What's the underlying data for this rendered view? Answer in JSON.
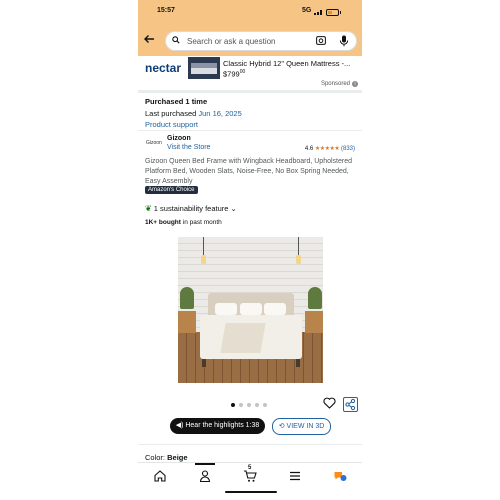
{
  "status": {
    "time": "15:57",
    "network": "5G"
  },
  "search": {
    "placeholder": "Search or ask a question"
  },
  "ad": {
    "brand": "nectar",
    "title": "Classic Hybrid 12\" Queen Mattress -...",
    "price_whole": "$799",
    "price_fraction": "00",
    "sponsored": "Sponsored",
    "info_icon": "i"
  },
  "purchase": {
    "times": "Purchased 1 time",
    "last_prefix": "Last purchased",
    "last_date": "Jun 16, 2025",
    "support": "Product support"
  },
  "seller": {
    "logo": "Gizoon",
    "name": "Gizoon",
    "store_link": "Visit the Store",
    "rating": "4.6",
    "stars": "★★★★★",
    "review_count": "(833)"
  },
  "product": {
    "description": "Gizoon Queen Bed Frame with Wingback Headboard, Upholstered Platform Bed, Wooden Slats, Noise-Free, No Box Spring Needed, Easy Assembly",
    "badge": "Amazon's Choice",
    "sustainability": "1 sustainability feature",
    "bought_bold": "1K+ bought",
    "bought_rest": " in past month"
  },
  "gallery": {
    "dot_count": 5,
    "active_dot": 0
  },
  "actions": {
    "highlights": "Hear the highlights 1:38",
    "view3d": "VIEW IN 3D"
  },
  "color": {
    "label": "Color:",
    "value": "Beige"
  },
  "nav": {
    "items": [
      "home-icon",
      "account-icon",
      "cart-icon",
      "menu-icon",
      "rufus-icon"
    ],
    "active": "account-icon",
    "cart_count": "5"
  },
  "colors": {
    "header": "#f6c586",
    "link": "#2162a1",
    "star": "#de7921",
    "badge": "#232f3e"
  }
}
